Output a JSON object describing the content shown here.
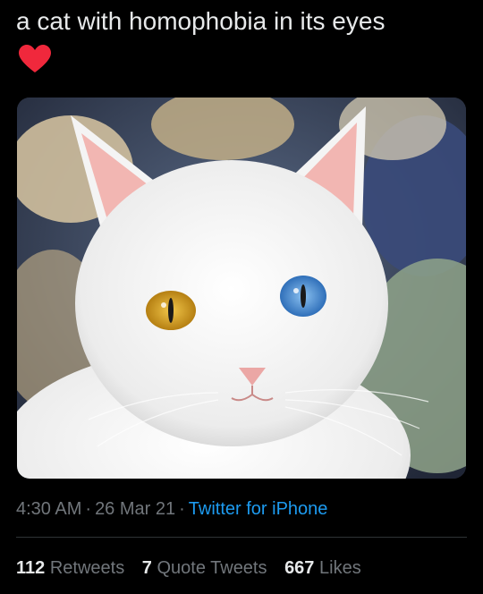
{
  "tweet": {
    "text": "a cat with homophobia in its eyes",
    "emoji": "heart-emoji",
    "media": {
      "subject": "white cat with one yellow eye and one blue eye",
      "eye_left_color": "#d9a51f",
      "eye_right_color": "#4f8fd6"
    },
    "time": "4:30 AM",
    "date": "26 Mar 21",
    "source": "Twitter for iPhone",
    "separator": "·"
  },
  "stats": {
    "retweets_count": "112",
    "retweets_label": "Retweets",
    "quotes_count": "7",
    "quotes_label": "Quote Tweets",
    "likes_count": "667",
    "likes_label": "Likes"
  },
  "colors": {
    "background": "#000000",
    "text": "#e7e9ea",
    "muted": "#71767b",
    "link": "#1d9bf0",
    "heart": "#f0283c",
    "divider": "#2f3336"
  }
}
